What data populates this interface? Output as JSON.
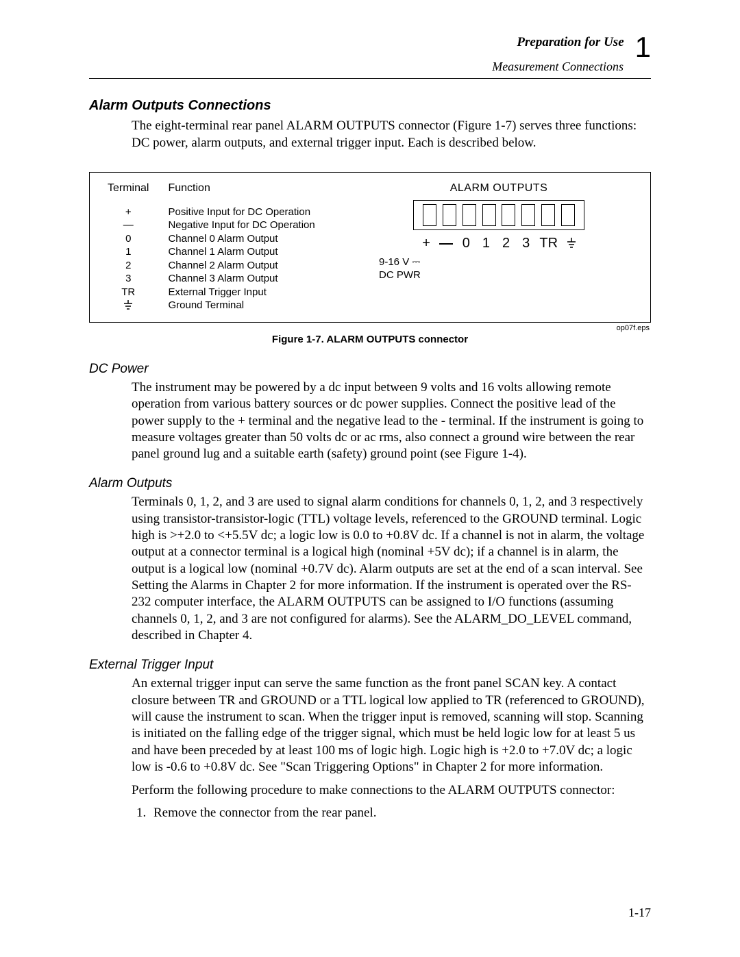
{
  "header": {
    "title": "Preparation for Use",
    "subtitle": "Measurement Connections",
    "chapter_number": "1"
  },
  "section": {
    "title": "Alarm Outputs Connections",
    "intro": "The eight-terminal rear panel ALARM OUTPUTS connector (Figure 1-7) serves three functions: DC power, alarm outputs, and external trigger input. Each is described below."
  },
  "figure": {
    "col_terminal": "Terminal",
    "col_function": "Function",
    "rows": [
      {
        "term": "+",
        "func": "Positive Input for DC Operation"
      },
      {
        "term": "—",
        "func": "Negative Input for DC Operation"
      },
      {
        "term": "0",
        "func": "Channel 0 Alarm Output"
      },
      {
        "term": "1",
        "func": "Channel 1 Alarm Output"
      },
      {
        "term": "2",
        "func": "Channel 2 Alarm Output"
      },
      {
        "term": "3",
        "func": "Channel 3 Alarm Output"
      },
      {
        "term": "TR",
        "func": "External Trigger Input"
      },
      {
        "term": "⏚",
        "func": "Ground Terminal"
      }
    ],
    "panel_label": "ALARM OUTPUTS",
    "pin_labels": [
      "+",
      "—",
      "0",
      "1",
      "2",
      "3",
      "TR",
      "⏚"
    ],
    "dc_line1": "9-16 V ⎓",
    "dc_line2": "DC PWR",
    "eps": "op07f.eps",
    "caption": "Figure 1-7. ALARM OUTPUTS connector"
  },
  "dc_power": {
    "title": "DC Power",
    "body": "The instrument may be powered by a dc input between 9 volts and 16 volts allowing remote operation from various battery sources or dc power supplies. Connect the positive lead of the power supply to the + terminal and the negative lead to the - terminal. If the instrument is going to measure voltages greater than 50 volts dc or ac rms, also connect a ground wire between the rear panel ground lug and a suitable earth (safety) ground point (see Figure 1-4)."
  },
  "alarm_outputs": {
    "title": "Alarm Outputs",
    "body": "Terminals 0, 1, 2, and 3 are used to signal alarm conditions for channels 0, 1, 2, and 3 respectively using transistor-transistor-logic (TTL) voltage levels, referenced to the GROUND terminal. Logic high is >+2.0 to <+5.5V dc; a logic low is 0.0 to +0.8V dc. If a channel is not in alarm, the voltage output at a connector terminal is a logical high (nominal +5V dc); if a channel is in alarm, the output is a logical low (nominal +0.7V dc). Alarm outputs are set at the end of a scan interval. See Setting the Alarms in Chapter 2 for more information. If the instrument is operated over the RS-232 computer interface, the ALARM OUTPUTS can be assigned to I/O functions (assuming channels 0, 1, 2, and 3 are not configured for alarms). See the ALARM_DO_LEVEL command, described in Chapter 4."
  },
  "ext_trigger": {
    "title": "External Trigger Input",
    "body1": "An external trigger input can serve the same function as the front panel SCAN key. A contact closure between TR and GROUND or a TTL logical low applied to TR (referenced to GROUND), will cause the instrument to scan. When the trigger input is removed, scanning will stop. Scanning is initiated on the falling edge of the trigger signal, which must be held logic low for at least 5 us and have been preceded by at least 100 ms of logic high. Logic high is +2.0 to +7.0V dc; a logic low is -0.6 to +0.8V dc. See \"Scan Triggering Options\" in Chapter 2 for more information.",
    "body2": "Perform the following procedure to make connections to the ALARM OUTPUTS connector:",
    "step1": "Remove the connector from the rear panel."
  },
  "page_number": "1-17"
}
